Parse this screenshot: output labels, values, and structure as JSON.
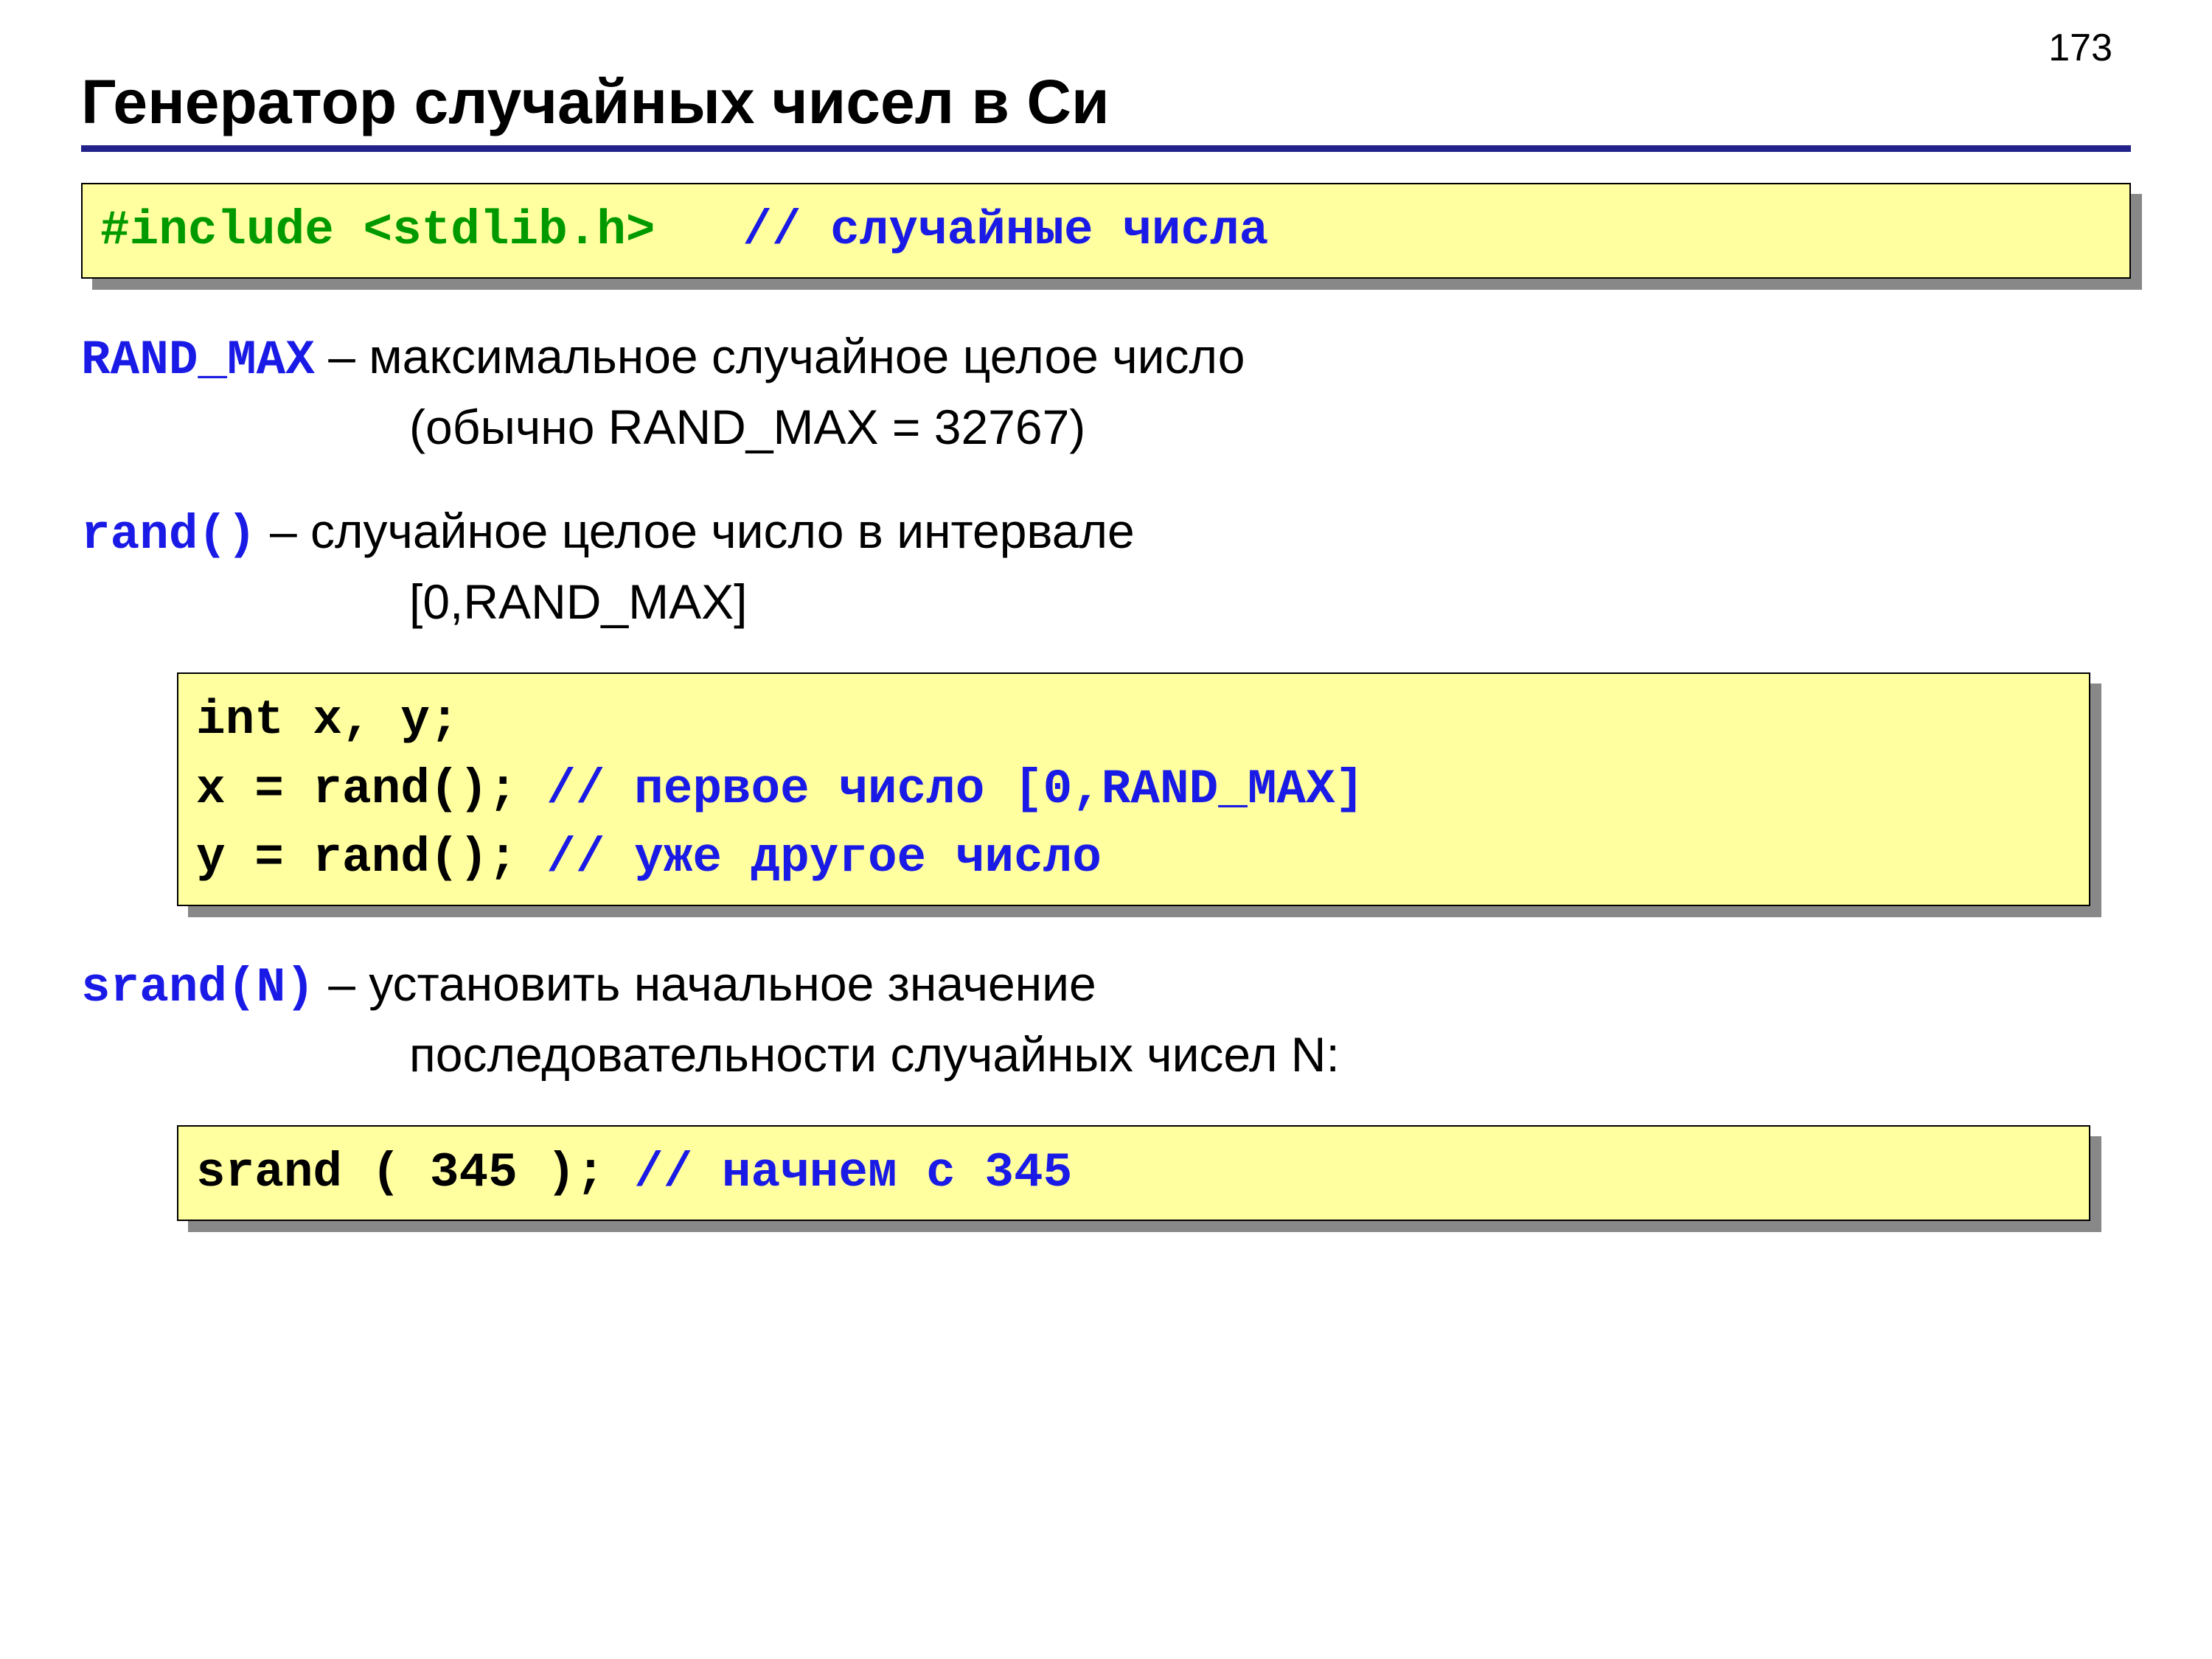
{
  "page_number": "173",
  "title": "Генератор случайных чисел в Си",
  "code1": {
    "include": "#include <stdlib.h>",
    "spacer": "   ",
    "comment": "// случайные числа"
  },
  "def1": {
    "kw": "RAND_MAX",
    "l1": " – максимальное случайное целое число",
    "l2": "(обычно RAND_MAX = 32767)"
  },
  "def2": {
    "kw": "rand()",
    "l1": "  – случайное целое число в интервале",
    "l2": "[0,RAND_MAX]"
  },
  "code2": {
    "l1": "int x, y;",
    "l2a": "x = rand(); ",
    "l2b": "// первое число [0,RAND_MAX]",
    "l3a": "y = rand(); ",
    "l3b": "// уже другое число"
  },
  "def3": {
    "kw": "srand(N)",
    "l1": " – установить начальное значение",
    "l2": "последовательности случайных чисел N:"
  },
  "code3": {
    "l1a": "srand ( 345 ); ",
    "l1b": "// начнем с 345"
  }
}
